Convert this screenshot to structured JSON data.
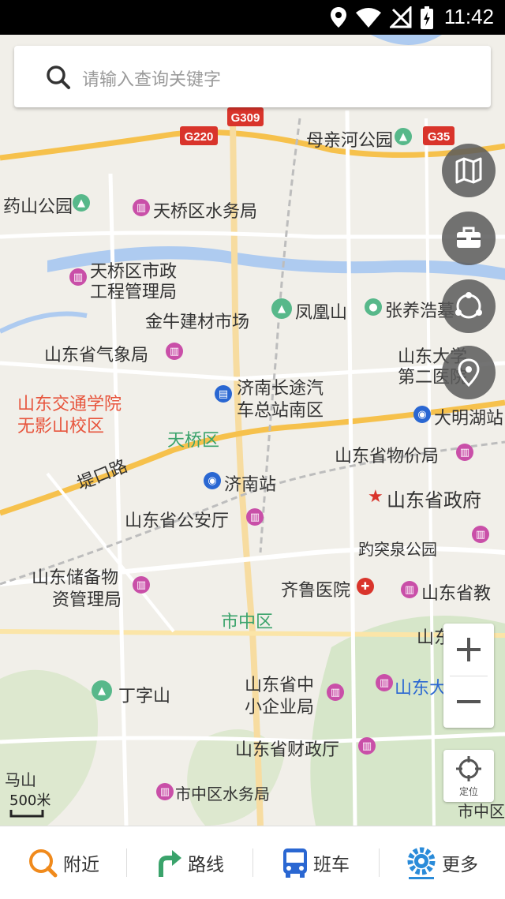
{
  "status_bar": {
    "time": "11:42"
  },
  "search": {
    "placeholder": "请输入查询关键字"
  },
  "map": {
    "road_shields": [
      "G309",
      "G220",
      "G35"
    ],
    "labels": {
      "muqinhe": "母亲河公园",
      "yaoshan": "药山公园",
      "tianqiao_water": "天桥区水务局",
      "tianqiao_eng_1": "天桥区市政",
      "tianqiao_eng_2": "工程管理局",
      "jinniu": "金牛建材市场",
      "fenghuang": "凤凰山",
      "zhangyang": "张养浩墓",
      "weather": "山东省气象局",
      "sdu_1": "山东大学",
      "sdu_2": "第二医院",
      "traffic_1": "山东交通学院",
      "traffic_2": "无影山校区",
      "bus_1": "济南长途汽",
      "bus_2": "车总站南区",
      "daminghu": "大明湖站",
      "tianqiao_district": "天桥区",
      "price": "山东省物价局",
      "dikou": "堤口路",
      "jinan_station": "济南站",
      "gov": "山东省政府",
      "police": "山东省公安厅",
      "baotu": "趵突泉公园",
      "reserve_1": "山东储备物",
      "reserve_2": "资管理局",
      "qilu": "齐鲁医院",
      "edu": "山东省教",
      "shizhong": "市中区",
      "shan_partial": "山东",
      "dingzi": "丁字山",
      "sme_1": "山东省中",
      "sme_2": "小企业局",
      "sdu_short": "山东大",
      "finance": "山东省财政厅",
      "mashan": "马山",
      "sz_water": "市中区水务局",
      "sz_right": "市中区"
    },
    "scale": "500米"
  },
  "controls": {
    "locate_label": "定位"
  },
  "bottom_tabs": [
    {
      "label": "附近"
    },
    {
      "label": "路线"
    },
    {
      "label": "班车"
    },
    {
      "label": "更多"
    }
  ]
}
